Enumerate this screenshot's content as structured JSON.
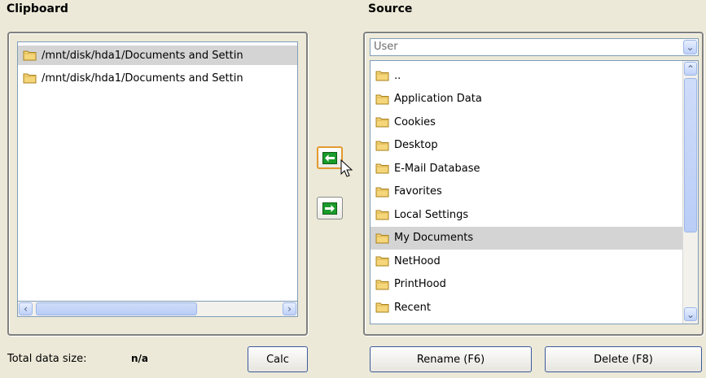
{
  "clipboard": {
    "title": "Clipboard",
    "items": [
      "/mnt/disk/hda1/Documents and Settin",
      "/mnt/disk/hda1/Documents and Settin"
    ]
  },
  "source": {
    "title": "Source",
    "dropdown_value": "User",
    "items": [
      "..",
      "Application Data",
      "Cookies",
      "Desktop",
      "E-Mail Database",
      "Favorites",
      "Local Settings",
      "My Documents",
      "NetHood",
      "PrintHood",
      "Recent"
    ],
    "selected": "My Documents"
  },
  "footer": {
    "total_label": "Total data size:",
    "total_value": "n/a",
    "calc_label": "Calc",
    "rename_label": "Rename (F6)",
    "delete_label": "Delete (F8)"
  },
  "icons": {
    "folder": "folder-icon",
    "move_left": "arrow-left-icon",
    "move_right": "arrow-right-icon",
    "cursor": "mouse-pointer-icon"
  },
  "colors": {
    "window_bg": "#ece9d8",
    "folder_yellow": "#f5d67a",
    "arrow_green": "#1a9b2a",
    "selection_gray": "#d4d4d4"
  }
}
